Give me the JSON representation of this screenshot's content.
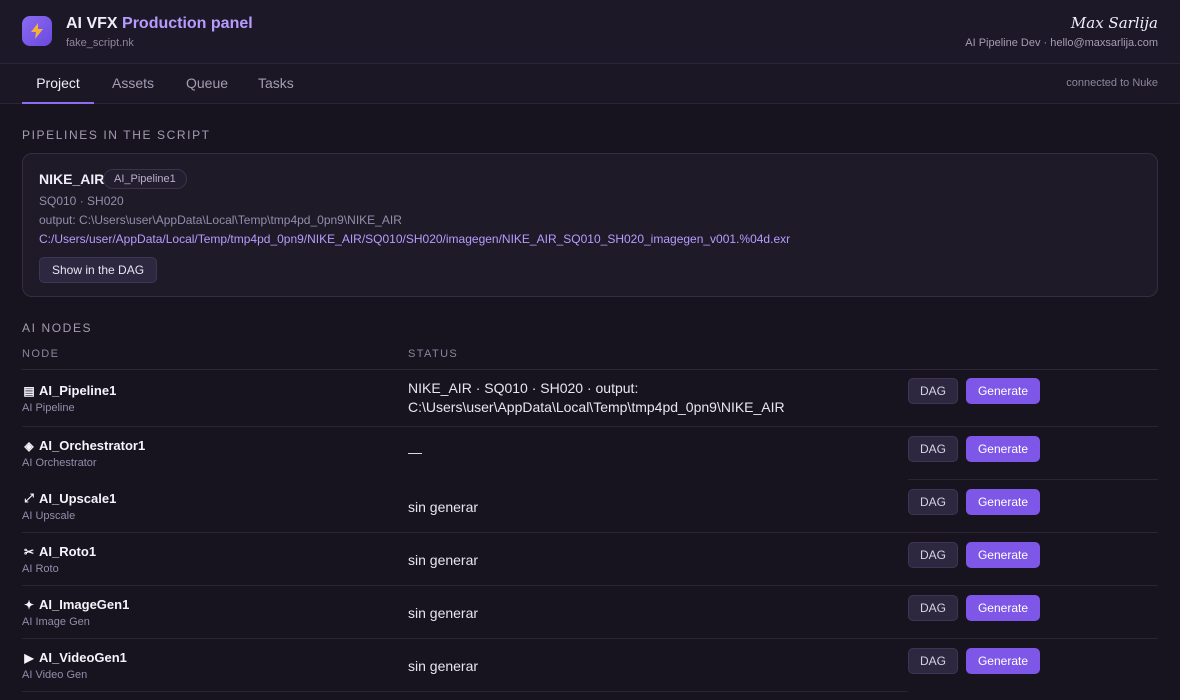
{
  "header": {
    "title_prefix": "AI VFX",
    "title_accent": "Production panel",
    "file": "fake_script.nk",
    "user_name": "Max Sarlija",
    "user_meta": "AI Pipeline Dev · hello@maxsarlija.com",
    "logo_icon": "lightning-icon"
  },
  "tabs": [
    {
      "label": "Project",
      "active": true
    },
    {
      "label": "Assets",
      "active": false
    },
    {
      "label": "Queue",
      "active": false
    },
    {
      "label": "Tasks",
      "active": false
    }
  ],
  "connection_status": "connected to Nuke",
  "pipelines": {
    "section_title": "PIPELINES IN THE SCRIPT",
    "items": [
      {
        "name": "NIKE_AIR",
        "node": "AI_Pipeline1",
        "shots": "SQ010 · SH020",
        "output": "output: C:\\Users\\user\\AppData\\Local\\Temp\\tmp4pd_0pn9\\NIKE_AIR",
        "path": "C:/Users/user/AppData/Local/Temp/tmp4pd_0pn9/NIKE_AIR/SQ010/SH020/imagegen/NIKE_AIR_SQ010_SH020_imagegen_v001.%04d.exr",
        "button": "Show in the DAG"
      }
    ]
  },
  "nodes": {
    "section_title": "AI NODES",
    "col_node": "NODE",
    "col_status": "STATUS",
    "dag_label": "DAG",
    "generate_label": "Generate",
    "rows": [
      {
        "icon": "▤",
        "icon_name": "pipeline-icon",
        "name": "AI_Pipeline1",
        "type": "AI Pipeline",
        "status_line1": "NIKE_AIR · SQ010 · SH020 · output:",
        "status_line2": "C:\\Users\\user\\AppData\\Local\\Temp\\tmp4pd_0pn9\\NIKE_AIR"
      },
      {
        "icon": "◈",
        "icon_name": "orchestrator-icon",
        "name": "AI_Orchestrator1",
        "type": "AI Orchestrator",
        "status_line1": "—",
        "status_line2": ""
      },
      {
        "icon": "⤢",
        "icon_name": "upscale-icon",
        "name": "AI_Upscale1",
        "type": "AI Upscale",
        "status_line1": "sin generar",
        "status_line2": ""
      },
      {
        "icon": "✂",
        "icon_name": "scissors-icon",
        "name": "AI_Roto1",
        "type": "AI Roto",
        "status_line1": "sin generar",
        "status_line2": ""
      },
      {
        "icon": "✦",
        "icon_name": "sparkle-icon",
        "name": "AI_ImageGen1",
        "type": "AI Image Gen",
        "status_line1": "sin generar",
        "status_line2": ""
      },
      {
        "icon": "▶",
        "icon_name": "play-icon",
        "name": "AI_VideoGen1",
        "type": "AI Video Gen",
        "status_line1": "sin generar",
        "status_line2": ""
      }
    ]
  },
  "colors": {
    "accent": "#7e57e8",
    "accent_text": "#b79cff",
    "background": "#17131f"
  }
}
